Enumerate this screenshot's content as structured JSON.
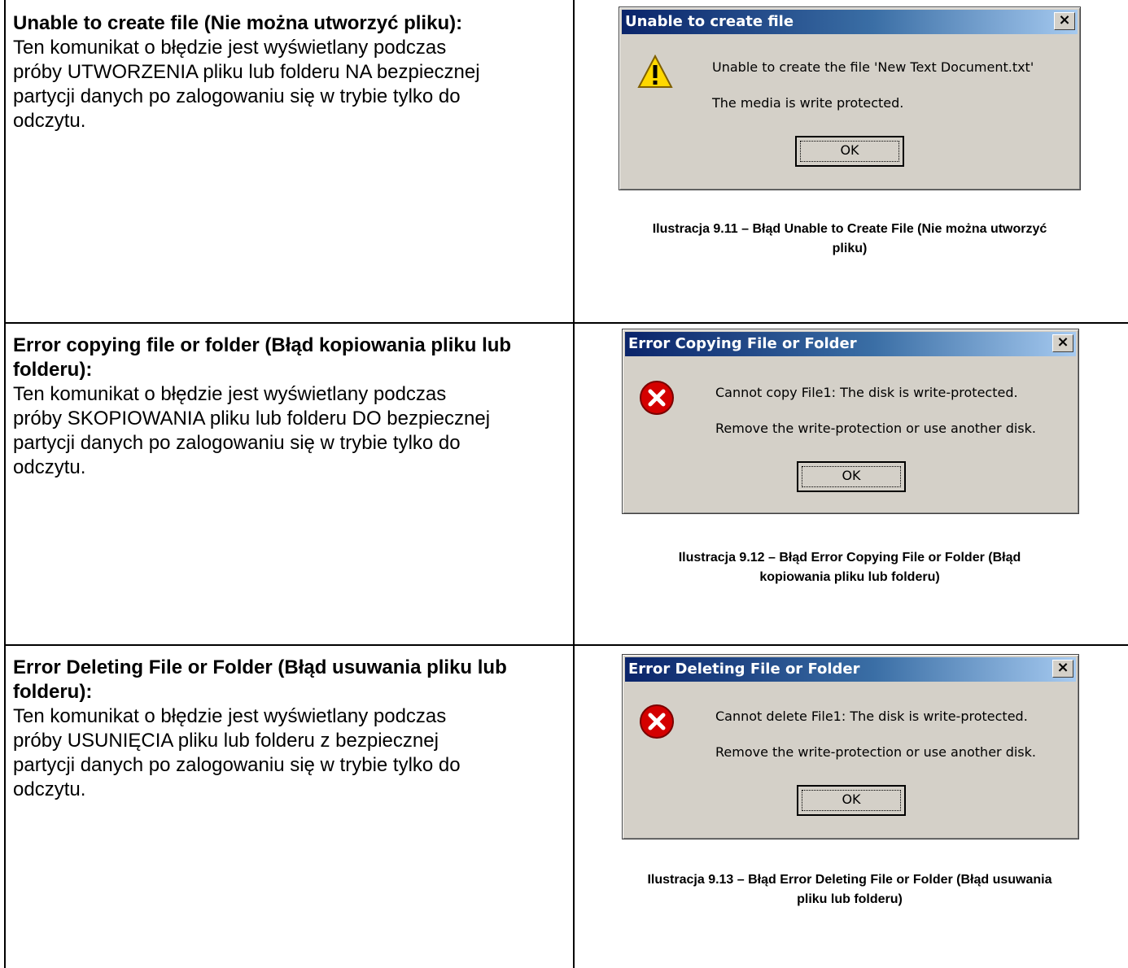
{
  "rows": [
    {
      "heading": "Unable to create file (Nie można utworzyć pliku):",
      "lines": [
        "Ten komunikat o błędzie jest wyświetlany podczas",
        "próby UTWORZENIA pliku lub folderu NA bezpiecznej",
        "partycji danych po zalogowaniu się w trybie tylko do",
        "odczytu."
      ],
      "dialog": {
        "title": "Unable to create file",
        "icon": "warning-icon",
        "message_1": "Unable to create the file 'New Text Document.txt'",
        "message_2": "The media is write protected.",
        "ok_label": "OK",
        "close_glyph": "×"
      },
      "caption_1": "Ilustracja 9.11 – Błąd Unable to Create File (Nie można utworzyć",
      "caption_2": "pliku)"
    },
    {
      "heading_1": "Error copying file or folder (Błąd kopiowania pliku lub",
      "heading_2": "folderu):",
      "lines": [
        "Ten komunikat o błędzie jest wyświetlany podczas",
        "próby SKOPIOWANIA pliku lub folderu DO bezpiecznej",
        "partycji danych po zalogowaniu się w trybie tylko do",
        "odczytu."
      ],
      "dialog": {
        "title": "Error Copying File or Folder",
        "icon": "error-icon",
        "message_1": "Cannot copy File1: The disk is write-protected.",
        "message_2": "Remove the write-protection or use another disk.",
        "ok_label": "OK",
        "close_glyph": "×"
      },
      "caption_1": "Ilustracja 9.12 – Błąd Error Copying File or Folder (Błąd",
      "caption_2": "kopiowania pliku lub folderu)"
    },
    {
      "heading_1": "Error Deleting File or Folder (Błąd usuwania pliku lub",
      "heading_2": "folderu):",
      "lines": [
        "Ten komunikat o błędzie jest wyświetlany podczas",
        "próby USUNIĘCIA pliku lub folderu z bezpiecznej",
        "partycji danych po zalogowaniu się w trybie tylko do",
        "odczytu."
      ],
      "dialog": {
        "title": "Error Deleting File or Folder",
        "icon": "error-icon",
        "message_1": "Cannot delete File1: The disk is write-protected.",
        "message_2": "Remove the write-protection or use another disk.",
        "ok_label": "OK",
        "close_glyph": "×"
      },
      "caption_1": "Ilustracja 9.13 – Błąd Error Deleting File or Folder (Błąd usuwania",
      "caption_2": "pliku lub folderu)"
    }
  ]
}
